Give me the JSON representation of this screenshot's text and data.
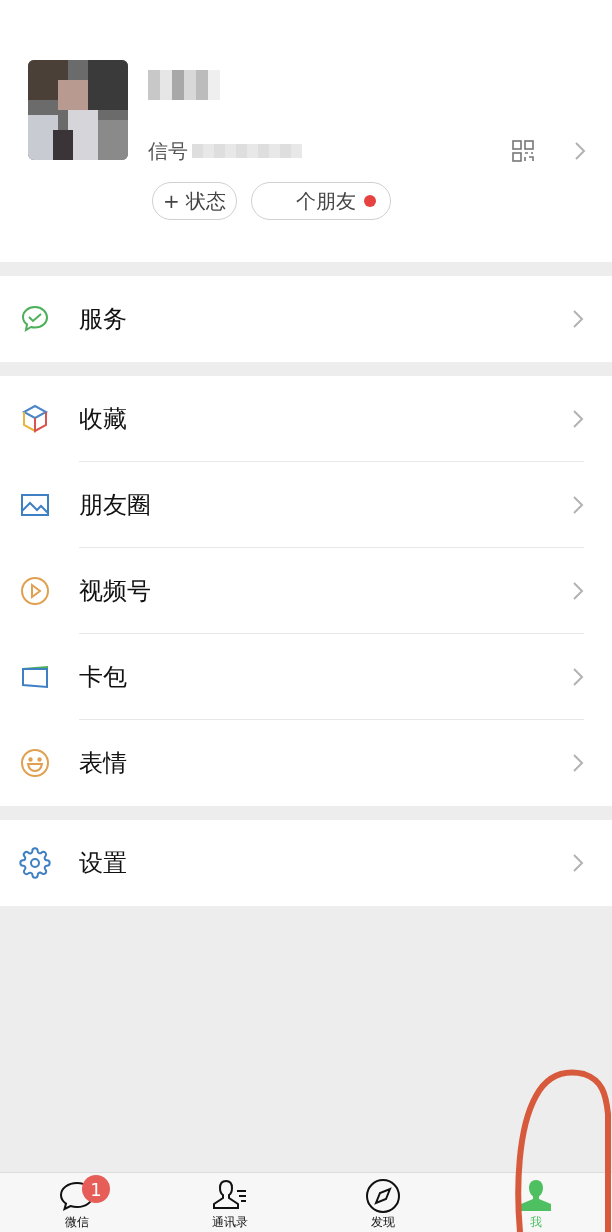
{
  "profile": {
    "id_label": "信号",
    "status_button": {
      "icon": "+",
      "label": "状态"
    },
    "friends_button": {
      "label": "个朋友",
      "unread": true
    }
  },
  "groups": [
    [
      {
        "label": "服务",
        "kind": "service"
      }
    ],
    [
      {
        "label": "收藏",
        "kind": "favorites"
      },
      {
        "label": "朋友圈",
        "kind": "moments"
      },
      {
        "label": "视频号",
        "kind": "channels"
      },
      {
        "label": "卡包",
        "kind": "cards"
      },
      {
        "label": "表情",
        "kind": "stickers"
      }
    ],
    [
      {
        "label": "设置",
        "kind": "settings"
      }
    ]
  ],
  "tab_bar": [
    {
      "label": "微信",
      "kind": "chats",
      "badge": "1",
      "selected": false
    },
    {
      "label": "通讯录",
      "kind": "contacts",
      "selected": false
    },
    {
      "label": "发现",
      "kind": "discover",
      "selected": false
    },
    {
      "label": "我",
      "kind": "me",
      "selected": true
    }
  ]
}
